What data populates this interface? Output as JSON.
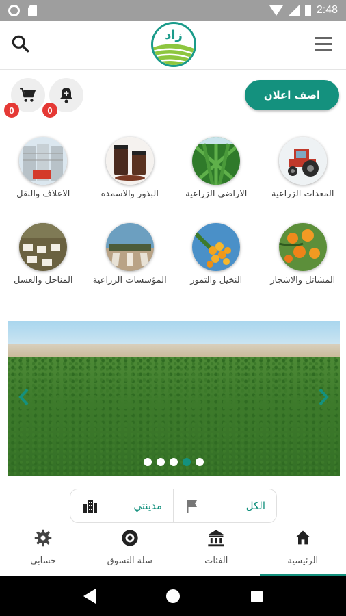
{
  "status_bar": {
    "time": "2:48"
  },
  "header": {
    "logo_text": "زاد"
  },
  "actions": {
    "add_ad_label": "اضف اعلان",
    "cart_count": "0",
    "notifications_count": "0"
  },
  "categories": [
    {
      "label": "المعدات الزراعية",
      "icon": "tractor"
    },
    {
      "label": "الاراضي الزراعية",
      "icon": "crop-field"
    },
    {
      "label": "البذور والاسمدة",
      "icon": "seed-jars"
    },
    {
      "label": "الاعلاف والنقل",
      "icon": "grain-silo"
    },
    {
      "label": "المشاتل والاشجار",
      "icon": "orange-tree"
    },
    {
      "label": "النخيل والتمور",
      "icon": "dates"
    },
    {
      "label": "المؤسسات الزراعية",
      "icon": "greenhouse"
    },
    {
      "label": "المناحل والعسل",
      "icon": "beehives"
    }
  ],
  "carousel": {
    "slide_count": 5,
    "active_index": 3
  },
  "filter": {
    "all_label": "الكل",
    "city_label": "مدينتي"
  },
  "bottom_nav": [
    {
      "label": "الرئيسية",
      "icon": "home-icon",
      "active": true
    },
    {
      "label": "الفئات",
      "icon": "institution-icon",
      "active": false
    },
    {
      "label": "سلة التسوق",
      "icon": "basket-icon",
      "active": false
    },
    {
      "label": "حسابي",
      "icon": "gear-icon",
      "active": false
    }
  ],
  "colors": {
    "accent": "#14917e",
    "badge": "#e53935"
  }
}
